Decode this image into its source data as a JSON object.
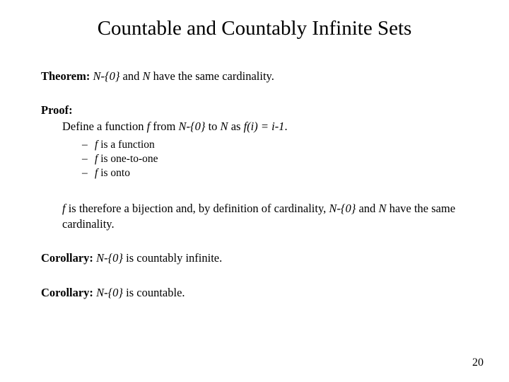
{
  "title": "Countable and Countably Infinite Sets",
  "theorem": {
    "label": "Theorem:",
    "set1": "N-{0}",
    "mid": " and ",
    "set2": "N",
    "rest": " have the same cardinality."
  },
  "proof": {
    "label": "Proof:",
    "body_pre": "Define a function ",
    "f": "f",
    "body_mid1": " from ",
    "d1": "N-{0}",
    "body_mid2": " to ",
    "d2": "N",
    "body_mid3": " as ",
    "eq": "f(i) = i-1",
    "body_end": ".",
    "props": [
      {
        "f": "f",
        "rest": "  is a function"
      },
      {
        "f": "f",
        "rest": "  is one-to-one"
      },
      {
        "f": "f",
        "rest": "  is onto"
      }
    ],
    "concl_f": "f",
    "concl_mid": " is therefore a bijection and, by definition of cardinality, ",
    "concl_s1": "N-{0}",
    "concl_and": " and ",
    "concl_s2": "N",
    "concl_rest": " have the same cardinality.   "
  },
  "cor1": {
    "label": "Corollary:",
    "set": "N-{0}",
    "rest": " is countably infinite."
  },
  "cor2": {
    "label": "Corollary:",
    "set": "N-{0}",
    "rest": " is countable."
  },
  "page": "20"
}
